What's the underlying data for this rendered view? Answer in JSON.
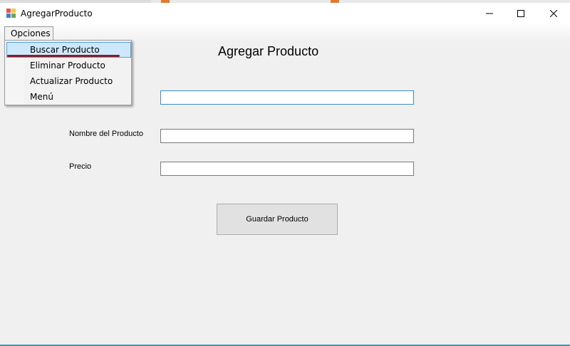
{
  "window": {
    "title": "AgregarProducto",
    "minimize_glyph": "—",
    "maximize_glyph": "☐",
    "close_glyph": "✕"
  },
  "menubar": {
    "opciones_label": "Opciones"
  },
  "dropdown": {
    "items": [
      {
        "label": "Buscar Producto",
        "highlighted": true
      },
      {
        "label": "Eliminar Producto"
      },
      {
        "label": "Actualizar Producto"
      },
      {
        "label": "Menú"
      }
    ]
  },
  "form": {
    "title": "Agregar Producto",
    "fields": {
      "id": {
        "value": ""
      },
      "nombre": {
        "label": "Nombre del Producto",
        "value": ""
      },
      "precio": {
        "label": "Precio",
        "value": ""
      }
    },
    "save_label": "Guardar Producto"
  },
  "colors": {
    "client_bg": "#f0f0f0",
    "highlight_bg": "#cde8fc",
    "highlight_border": "#4f9fdc",
    "focus_border": "#3c8ac6",
    "annotation_underline": "#8a1b2a"
  }
}
